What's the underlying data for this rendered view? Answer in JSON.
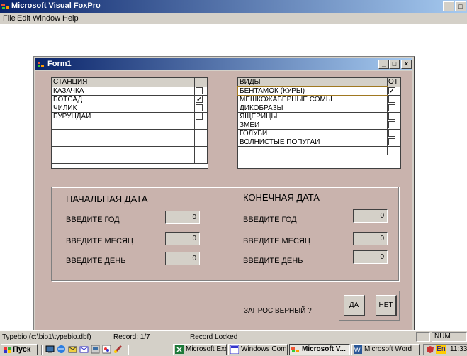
{
  "app": {
    "title": "Microsoft Visual FoxPro",
    "minimize_glyph": "_",
    "restore_glyph": "□"
  },
  "menu": [
    "File",
    "Edit",
    "Window",
    "Help"
  ],
  "form": {
    "title": "Form1",
    "minimize_glyph": "_",
    "maximize_glyph": "□",
    "close_glyph": "×"
  },
  "stations": {
    "header": "СТАНЦИЯ",
    "rows": [
      {
        "name": "КАЗАЧКА",
        "checked": false
      },
      {
        "name": "БОТСАД",
        "checked": true
      },
      {
        "name": "ЧИЛИК",
        "checked": false
      },
      {
        "name": "БУРУНДАЙ",
        "checked": false
      }
    ]
  },
  "species": {
    "header": "ВИДЫ",
    "header2": "ОТ",
    "rows": [
      {
        "name": "БЕНТАМОК (КУРЫ)",
        "checked": true
      },
      {
        "name": "МЕШКОЖАБЕРНЫЕ СОМЫ",
        "checked": false
      },
      {
        "name": "ДИКОБРАЗЫ",
        "checked": false
      },
      {
        "name": "ЯЩЕРИЦЫ",
        "checked": false
      },
      {
        "name": "ЗМЕИ",
        "checked": false
      },
      {
        "name": "ГОЛУБИ",
        "checked": false
      },
      {
        "name": "ВОЛНИСТЫЕ ПОПУГАИ",
        "checked": false
      }
    ]
  },
  "dates": {
    "start_title": "НАЧАЛЬНАЯ ДАТА",
    "end_title": "КОНЕЧНАЯ ДАТА",
    "start": {
      "year_label": "ВВЕДИТЕ ГОД",
      "year_value": "0",
      "month_label": "ВВЕДИТЕ  МЕСЯЦ",
      "month_value": "0",
      "day_label": "ВВЕДИТЕ  ДЕНЬ",
      "day_value": "0"
    },
    "end": {
      "year_label": "ВВЕДИТЕ  ГОД",
      "year_value": "0",
      "month_label": "ВВЕДИТЕ МЕСЯЦ",
      "month_value": "0",
      "day_label": "ВВЕДИТЕ  ДЕНЬ",
      "day_value": "0"
    }
  },
  "confirm": {
    "question": "ЗАПРОС ВЕРНЫЙ ?",
    "yes": "ДА",
    "no": "НЕТ"
  },
  "status": {
    "file": "Typebio (c:\\bio1\\typebio.dbf)",
    "record": "Record: 1/7",
    "lock": "Record Locked",
    "num": "NUM"
  },
  "taskbar": {
    "start_label": "Пуск",
    "tasks": [
      {
        "label": "Microsoft Exc...",
        "active": false
      },
      {
        "label": "Windows Com...",
        "active": false
      },
      {
        "label": "Microsoft V...",
        "active": true
      },
      {
        "label": "Microsoft Word",
        "active": false
      }
    ],
    "lang": "En",
    "clock": "11:33"
  },
  "colors": {
    "form_bg": "#c9b3ad",
    "title_gradient_start": "#0a246a",
    "title_gradient_end": "#a6caf0"
  }
}
